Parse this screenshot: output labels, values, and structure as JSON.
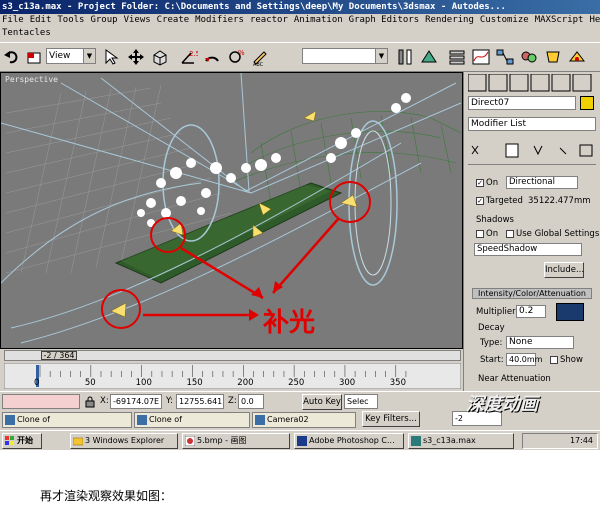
{
  "window": {
    "title": "s3_c13a.max  - Project Folder: C:\\Documents and Settings\\deep\\My Documents\\3dsmax   - Autodes..."
  },
  "menu": {
    "row1": [
      "File",
      "Edit",
      "Tools",
      "Group",
      "Views",
      "Create",
      "Modifiers",
      "reactor",
      "Animation",
      "Graph Editors",
      "Rendering",
      "Customize",
      "MAXScript",
      "Help"
    ],
    "row2": [
      "Tentacles"
    ]
  },
  "toolbar": {
    "view_combo": "View",
    "selection_combo": ""
  },
  "viewport": {
    "label": "Perspective",
    "annotation": "补光"
  },
  "command_panel": {
    "object_name": "Direct07",
    "modifier_list": "Modifier List",
    "on_label": "On",
    "light_type": "Directional",
    "targeted_label": "Targeted",
    "targeted_value": "35122.477mm",
    "shadows_header": "Shadows",
    "shadows_on_label": "On",
    "use_global_label": "Use Global Settings",
    "shadow_type": "SpeedShadow",
    "include_button": "Include...",
    "intensity_header": "Intensity/Color/Attenuation",
    "multiplier_label": "Multiplier:",
    "multiplier_value": "0.2",
    "decay_header": "Decay",
    "type_label": "Type:",
    "decay_type": "None",
    "start_label": "Start:",
    "start_value": "40.0mm",
    "show_label": "Show",
    "near_atten_label": "Near Attenuation",
    "light_color": "#1a3a6e"
  },
  "timeline": {
    "frame_counter": "-2 / 364",
    "ticks": [
      "0",
      "50",
      "100",
      "150",
      "200",
      "250",
      "300",
      "350"
    ]
  },
  "status": {
    "x_value": "-69174.07E",
    "y_value": "12755.641",
    "z_value": "0.0",
    "auto_key": "Auto Key",
    "selected": "Selec",
    "key_filters": "Key Filters...",
    "frame_field": "-2",
    "watermark": "深度动画"
  },
  "minimized": [
    {
      "label": "Clone of"
    },
    {
      "label": "Clone of"
    },
    {
      "label": "Camera02"
    }
  ],
  "taskbar": {
    "start": "开始",
    "items": [
      {
        "label": "3 Windows Explorer"
      },
      {
        "label": "5.bmp - 画图"
      },
      {
        "label": "Adobe Photoshop C..."
      },
      {
        "label": "s3_c13a.max"
      }
    ],
    "clock": "17:44"
  },
  "caption": "再才渲染观察效果如图："
}
